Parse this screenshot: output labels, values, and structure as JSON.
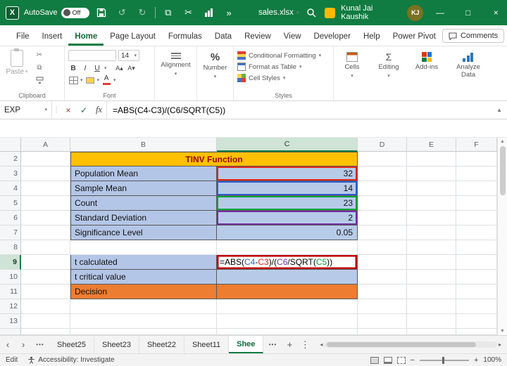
{
  "icons": {
    "close": "×",
    "minimize": "—",
    "maximize": "□",
    "undo": "↺",
    "redo": "↻",
    "cut": "✂",
    "copy": "⧉",
    "more_commands": "»",
    "ellipsis": "•••",
    "kebab": "⋮",
    "chevron_down": "▾",
    "nav_left": "‹",
    "nav_right": "›",
    "check": "✓",
    "cancel": "×",
    "plus": "+",
    "minus": "−",
    "scroll_left": "◂",
    "scroll_right": "▸",
    "scroll_up": "▲",
    "scroll_down": "▼",
    "percent": "%",
    "sigma": "Σ",
    "expand": "▲"
  },
  "titlebar": {
    "app_letter": "X",
    "autosave_label": "AutoSave",
    "autosave_state": "Off",
    "doc_title": "sales.xlsx",
    "user_name": "Kunal Jai Kaushik",
    "user_initials": "KJ"
  },
  "menubar": {
    "tabs": [
      "File",
      "Insert",
      "Home",
      "Page Layout",
      "Formulas",
      "Data",
      "Review",
      "View",
      "Developer",
      "Help",
      "Power Pivot"
    ],
    "active_tab": "Home",
    "comments_label": "Comments"
  },
  "ribbon": {
    "paste_label": "Paste",
    "bold": "B",
    "italic": "I",
    "underline": "U",
    "font_size": "14",
    "alignment_label": "Alignment",
    "number_label": "Number",
    "styles_items": [
      "Conditional Formatting",
      "Format as Table",
      "Cell Styles"
    ],
    "group_labels": {
      "clipboard": "Clipboard",
      "font": "Font",
      "styles": "Styles"
    },
    "cells_label": "Cells",
    "editing_label": "Editing",
    "addins_label": "Add-ins",
    "analyze_label": "Analyze Data"
  },
  "formula_bar": {
    "name_box": "EXP",
    "fx_label": "fx",
    "formula": "=ABS(C4-C3)/(C6/SQRT(C5))"
  },
  "grid": {
    "columns": [
      "A",
      "B",
      "C",
      "D",
      "E",
      "F"
    ],
    "rows": [
      "2",
      "3",
      "4",
      "5",
      "6",
      "7",
      "8",
      "9",
      "10",
      "11",
      "12",
      "13"
    ],
    "title_cell": "TINV Function",
    "labels": {
      "b3": "Population Mean",
      "b4": "Sample Mean",
      "b5": "Count",
      "b6": "Standard Deviation",
      "b7": "Significance Level",
      "b9": "t calculated",
      "b10": "t critical value",
      "b11": "Decision"
    },
    "values": {
      "c3": "32",
      "c4": "14",
      "c5": "23",
      "c6": "2",
      "c7": "0.05"
    },
    "c9_segments": [
      {
        "text": "=ABS(",
        "color": "#000000"
      },
      {
        "text": "C4",
        "color": "#2E5FD0"
      },
      {
        "text": "-",
        "color": "#000000"
      },
      {
        "text": "C3",
        "color": "#E2231A"
      },
      {
        "text": ")/(",
        "color": "#000000"
      },
      {
        "text": "C6",
        "color": "#7030A0"
      },
      {
        "text": "/SQRT(",
        "color": "#000000"
      },
      {
        "text": "C5",
        "color": "#00A33D"
      },
      {
        "text": "))",
        "color": "#000000"
      }
    ],
    "ref_border_colors": {
      "c3": "#E2231A",
      "c4": "#2E5FD0",
      "c5": "#00A33D",
      "c6": "#7030A0"
    },
    "colors": {
      "title_fill": "#FFC000",
      "title_text": "#9C0006",
      "data_fill": "#B4C6E7",
      "decision_fill": "#ED7D31",
      "edit_border": "#C00000",
      "excel_green": "#107C41"
    }
  },
  "sheet_tabs": {
    "tabs": [
      "Sheet25",
      "Sheet23",
      "Sheet22",
      "Sheet11"
    ],
    "active_tab": "Shee"
  },
  "status_bar": {
    "mode": "Edit",
    "accessibility": "Accessibility: Investigate",
    "zoom": "100%"
  }
}
